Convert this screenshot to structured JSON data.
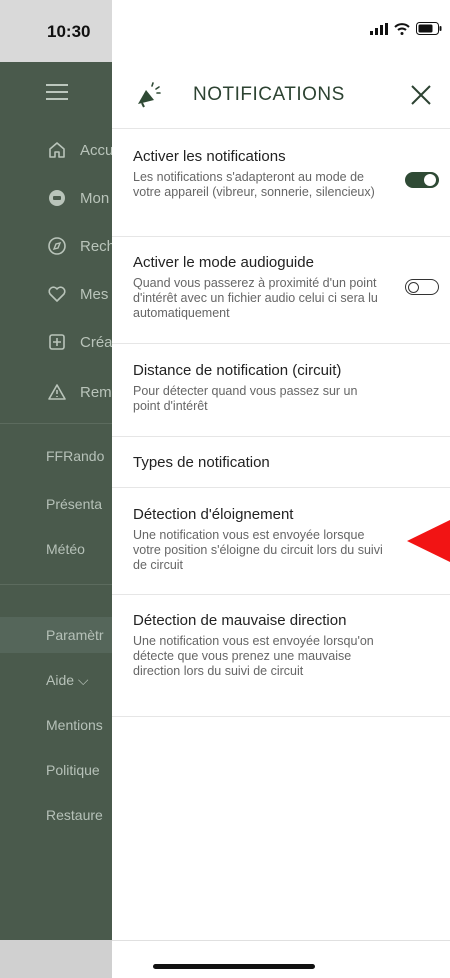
{
  "status_bar": {
    "time": "10:30"
  },
  "side_menu": {
    "items": [
      {
        "label": "Accu",
        "icon": "home-icon"
      },
      {
        "label": "Mon",
        "icon": "profile-icon"
      },
      {
        "label": "Rech",
        "icon": "compass-icon"
      },
      {
        "label": "Mes",
        "icon": "heart-icon"
      },
      {
        "label": "Créa",
        "icon": "plus-square-icon"
      },
      {
        "label": "Rem",
        "icon": "warning-icon"
      }
    ],
    "links": [
      "FFRando",
      "Présenta",
      "Météo",
      "Paramètr",
      "Aide",
      "Mentions",
      "Politique",
      "Restaure"
    ]
  },
  "panel": {
    "title": "NOTIFICATIONS",
    "settings": [
      {
        "title": "Activer les notifications",
        "desc": "Les notifications s'adapteront au mode de votre appareil (vibreur, sonnerie, silencieux)",
        "toggle": true
      },
      {
        "title": "Activer le mode audioguide",
        "desc": "Quand vous passerez à proximité d'un point d'intérêt avec un fichier audio celui ci sera lu automatiquement",
        "toggle": false
      },
      {
        "title": "Distance de notification (circuit)",
        "desc": "Pour détecter quand vous passez sur un point d'intérêt"
      },
      {
        "title": "Types de notification"
      },
      {
        "title": "Détection d'éloignement",
        "desc": "Une notification vous est envoyée lorsque votre position s'éloigne du circuit lors du suivi de circuit"
      },
      {
        "title": "Détection de mauvaise direction",
        "desc": "Une notification vous est envoyée lorsqu'on détecte que vous prenez une mauvaise direction lors du suivi de circuit"
      }
    ]
  },
  "colors": {
    "accent": "#2f4a35",
    "menu_bg": "#4a5a4c",
    "arrow": "#f21414"
  }
}
